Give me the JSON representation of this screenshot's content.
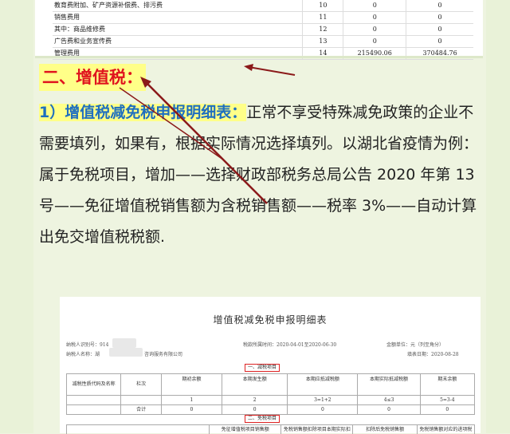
{
  "top_table": {
    "rows": [
      {
        "name": "教育费附加、矿产资源补偿费、排污费",
        "line": "10",
        "v1": "0",
        "v2": "0"
      },
      {
        "name": "销售费用",
        "line": "11",
        "v1": "0",
        "v2": "0"
      },
      {
        "name": "其中：商品维修费",
        "line": "12",
        "v1": "0",
        "v2": "0"
      },
      {
        "name": "广告费和业务宣传费",
        "line": "13",
        "v1": "0",
        "v2": "0"
      },
      {
        "name": "管理费用",
        "line": "14",
        "v1": "215490.06",
        "v2": "370484.76"
      }
    ]
  },
  "section_heading": "二、增值税：",
  "paragraph": {
    "lead": "1）增值税减免税申报明细表：",
    "text": "正常不享受特殊减免政策的企业不需要填列，如果有，根据实际情况选择填列。以湖北省疫情为例：属于免税项目，增加——选择财政部税务总局公告 2020 年第 13 号——免征增值税销售额为含税销售额——税率 3%——自动计算出免交增值税税额."
  },
  "form": {
    "title": "增值税减免税申报明细表",
    "taxpayer_id_label": "纳税人识别号：914",
    "taxpayer_name_label": "纳税人名称：湖",
    "taxpayer_name_suffix": "咨询服务有限公司",
    "period": "税款所属时间：2020-04-01至2020-06-30",
    "unit": "金额单位：元（列至角分）",
    "fill_date": "填表日期：2020-08-28",
    "reduce_section": "一、减税项目",
    "reduce_headers": {
      "code": "减税性质代码及名称",
      "col": "栏次",
      "opening": "期初余额",
      "occurred": "本期发生额",
      "deductible": "本期应抵减税额",
      "actual": "本期实际抵减税额",
      "closing": "期末余额"
    },
    "reduce_formulas": [
      "1",
      "2",
      "3=1+2",
      "4≤3",
      "5=3-4"
    ],
    "total_label": "合计",
    "total_values": [
      "0",
      "0",
      "0",
      "0",
      "0"
    ],
    "exempt_section": "二、免税项目",
    "exempt_headers": [
      "免征增值税项目销售额",
      "免税销售额扣除项目本期实际扣除金额",
      "扣除后免税销售额",
      "免税销售额对应的进项税额"
    ]
  },
  "colors": {
    "heading_red": "#e0141e",
    "lead_blue": "#1f6fbf",
    "highlight": "#ffff88",
    "arrow": "#8b1a1a"
  }
}
